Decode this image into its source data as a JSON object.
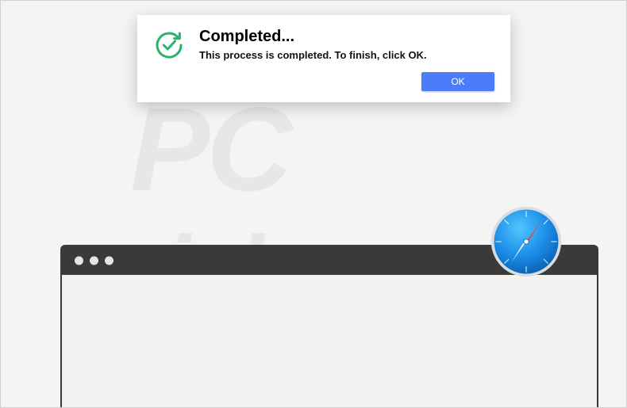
{
  "watermark": {
    "line1": "PC",
    "line2": "risk.com"
  },
  "dialog": {
    "title": "Completed...",
    "message": "This process is completed. To finish, click OK.",
    "ok_label": "OK",
    "icon_name": "check-refresh-icon",
    "icon_color": "#27b36a"
  },
  "browser": {
    "tab_label": "",
    "safari_icon_name": "safari-compass-icon"
  },
  "colors": {
    "dialog_button": "#4b7dfb",
    "titlebar": "#3a3a3a"
  }
}
